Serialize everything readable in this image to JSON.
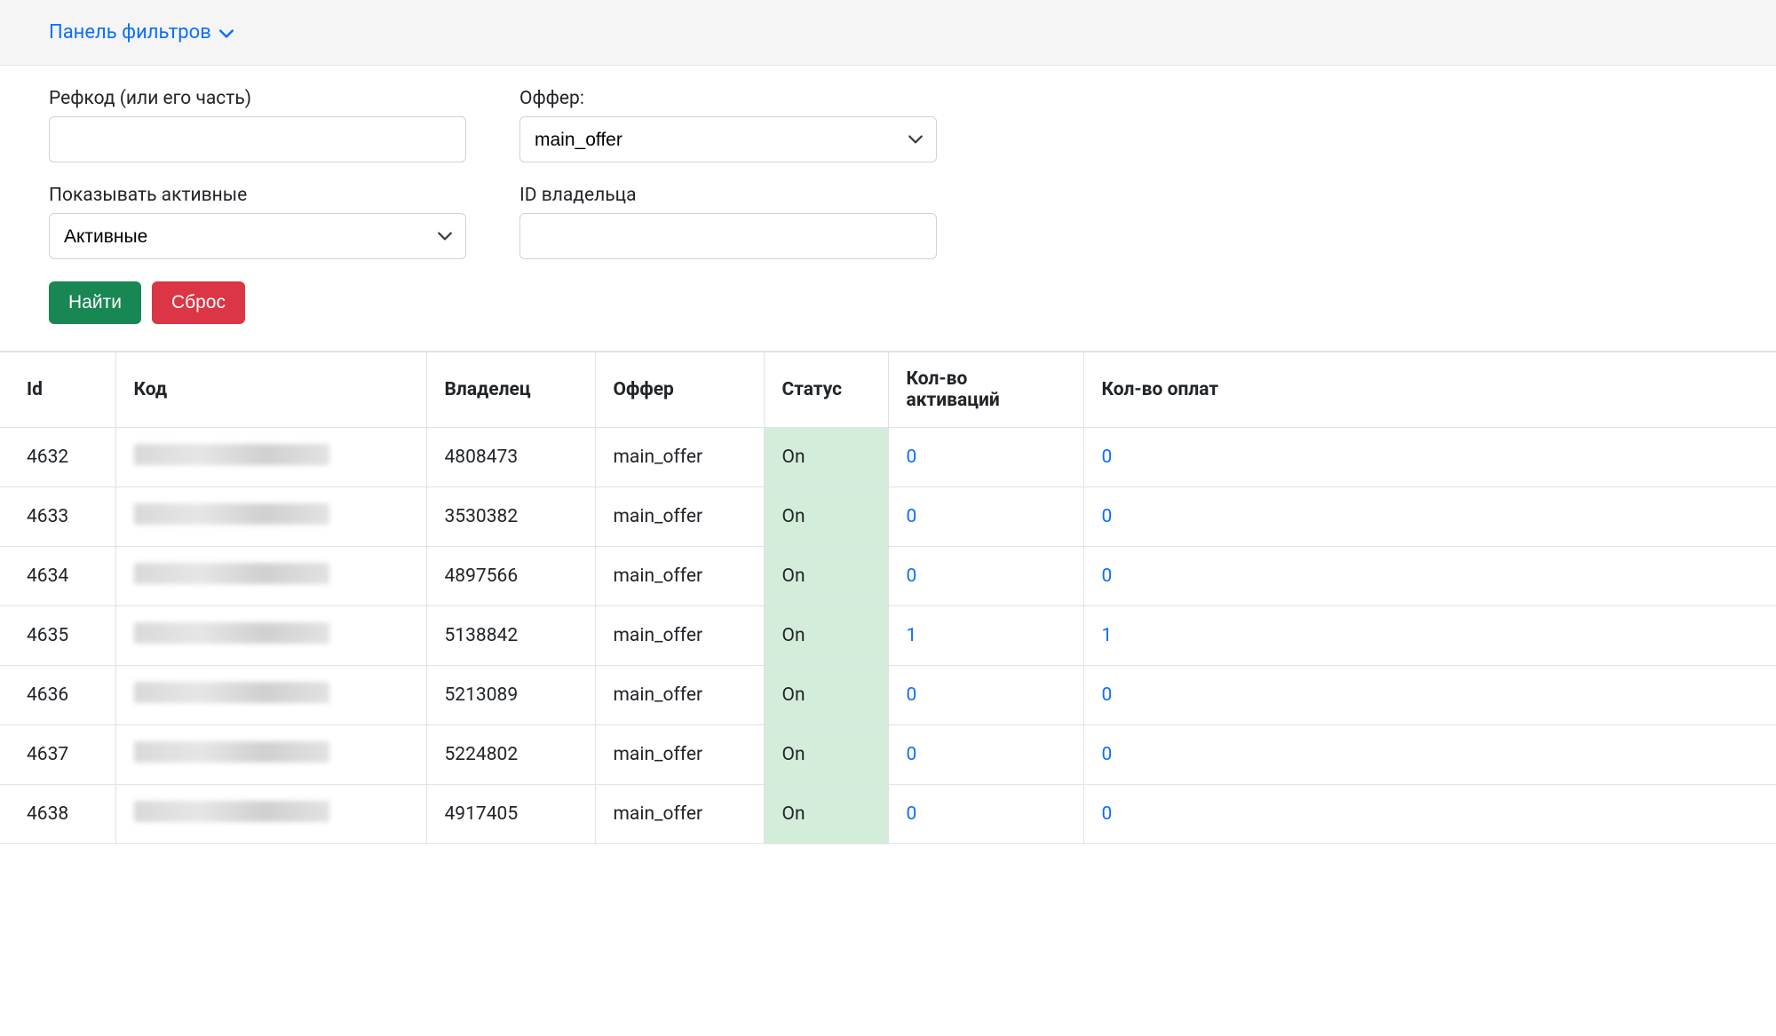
{
  "topbar": {
    "filter_toggle_label": "Панель фильтров"
  },
  "filters": {
    "refcode_label": "Рефкод (или его часть)",
    "refcode_value": "",
    "offer_label": "Оффер:",
    "offer_selected": "main_offer",
    "active_label": "Показывать активные",
    "active_selected": "Активные",
    "owner_id_label": "ID владельца",
    "owner_id_value": "",
    "search_btn": "Найти",
    "reset_btn": "Сброс"
  },
  "table": {
    "headers": {
      "id": "Id",
      "code": "Код",
      "owner": "Владелец",
      "offer": "Оффер",
      "status": "Статус",
      "activations": "Кол-во активаций",
      "payments": "Кол-во оплат"
    },
    "rows": [
      {
        "id": "4632",
        "owner": "4808473",
        "offer": "main_offer",
        "status": "On",
        "activations": "0",
        "payments": "0"
      },
      {
        "id": "4633",
        "owner": "3530382",
        "offer": "main_offer",
        "status": "On",
        "activations": "0",
        "payments": "0"
      },
      {
        "id": "4634",
        "owner": "4897566",
        "offer": "main_offer",
        "status": "On",
        "activations": "0",
        "payments": "0"
      },
      {
        "id": "4635",
        "owner": "5138842",
        "offer": "main_offer",
        "status": "On",
        "activations": "1",
        "payments": "1"
      },
      {
        "id": "4636",
        "owner": "5213089",
        "offer": "main_offer",
        "status": "On",
        "activations": "0",
        "payments": "0"
      },
      {
        "id": "4637",
        "owner": "5224802",
        "offer": "main_offer",
        "status": "On",
        "activations": "0",
        "payments": "0"
      },
      {
        "id": "4638",
        "owner": "4917405",
        "offer": "main_offer",
        "status": "On",
        "activations": "0",
        "payments": "0"
      }
    ]
  }
}
